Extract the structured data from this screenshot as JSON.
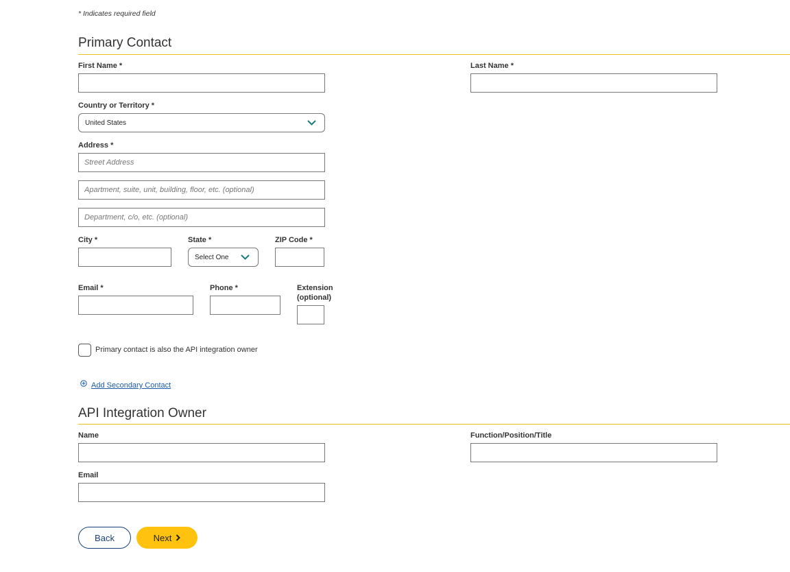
{
  "required_note": "* Indicates required field",
  "primary_contact": {
    "title": "Primary Contact",
    "first_name_label": "First Name *",
    "last_name_label": "Last Name *",
    "country_label": "Country or Territory *",
    "country_value": "United States",
    "address_label": "Address *",
    "street_placeholder": "Street Address",
    "apartment_placeholder": "Apartment, suite, unit, building, floor, etc. (optional)",
    "department_placeholder": "Department, c/o, etc. (optional)",
    "city_label": "City *",
    "state_label": "State *",
    "state_value": "Select One",
    "zip_label": "ZIP Code *",
    "email_label": "Email *",
    "phone_label": "Phone *",
    "extension_label_line1": "Extension",
    "extension_label_line2": "(optional)",
    "api_owner_checkbox_label": "Primary contact is also the API integration owner",
    "add_secondary_link": "Add Secondary Contact"
  },
  "api_owner": {
    "title": "API Integration Owner",
    "name_label": "Name",
    "function_label": "Function/Position/Title",
    "email_label": "Email"
  },
  "buttons": {
    "back": "Back",
    "next": "Next"
  },
  "colors": {
    "accent_rule": "#e8c21e",
    "next_button": "#ffc20e",
    "link": "#1a5aa8",
    "chevron": "#1a7a7a"
  },
  "icons": [
    "chevron-down-icon",
    "plus-circle-icon",
    "chevron-right-icon"
  ]
}
